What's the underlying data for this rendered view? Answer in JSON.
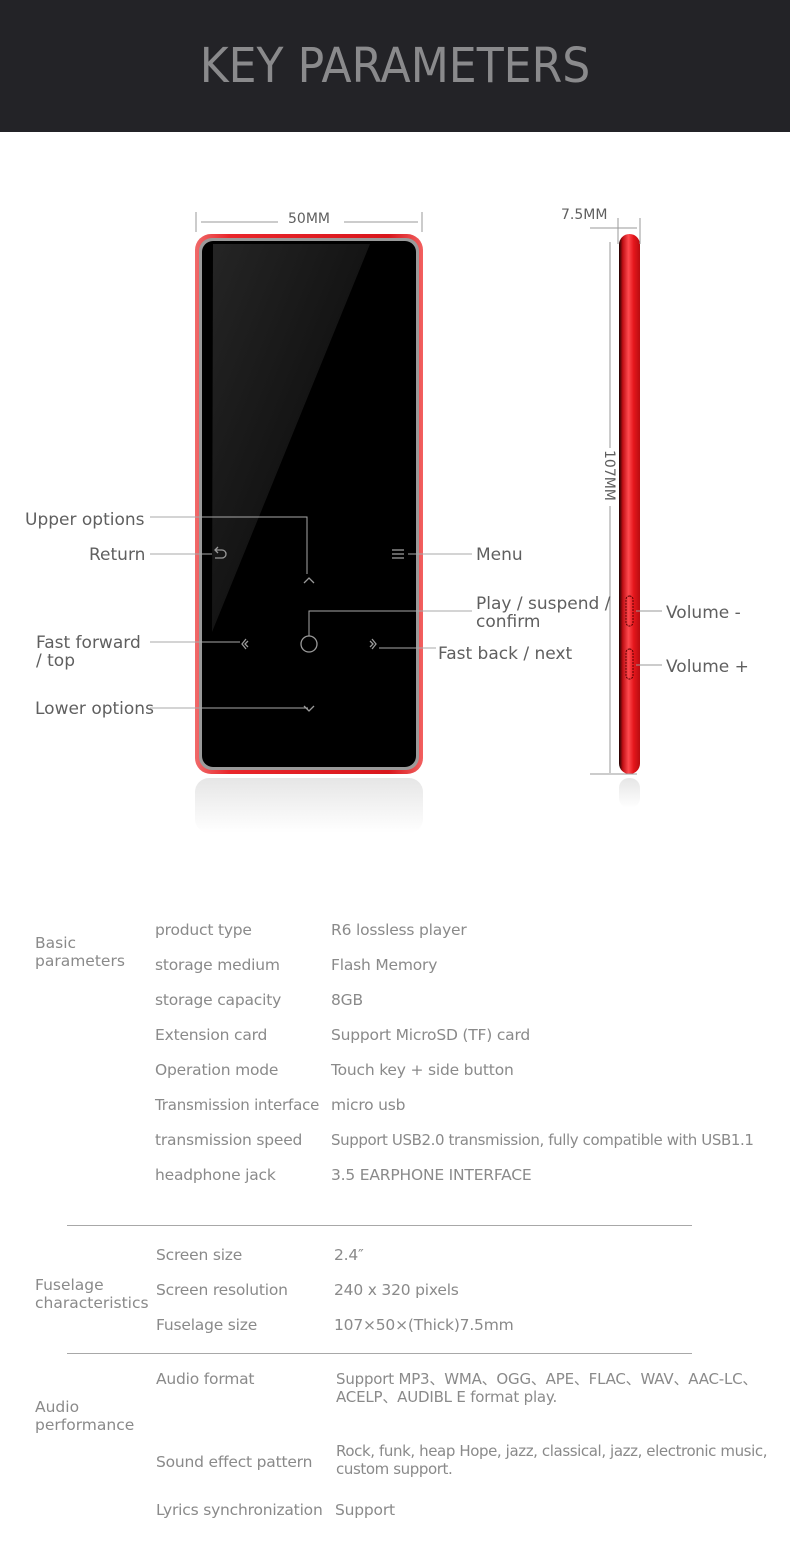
{
  "header": {
    "title": "KEY PARAMETERS"
  },
  "colors": {
    "header_bg": "#232327",
    "device_red": "#e8262b",
    "screen": "#000000",
    "text": "#8a8a8a"
  },
  "dimensions": {
    "width": "50MM",
    "thickness": "7.5MM",
    "height": "107MM"
  },
  "callouts": {
    "upper_options": "Upper options",
    "return": "Return",
    "menu": "Menu",
    "play_line1": "Play / suspend /",
    "play_line2": "confirm",
    "fast_forward_line1": "Fast forward",
    "fast_forward_line2": "/ top",
    "fast_back": "Fast back / next",
    "lower_options": "Lower options",
    "volume_minus": "Volume -",
    "volume_plus": "Volume +"
  },
  "icons": {
    "return": "return-arrow-icon",
    "up": "chevron-up-icon",
    "menu": "menu-lines-icon",
    "play": "circle-play-icon",
    "prev": "double-chevron-left-icon",
    "next": "double-chevron-right-icon",
    "down": "chevron-down-icon"
  },
  "specs": [
    {
      "group_line1": "Basic",
      "group_line2": "parameters",
      "rows": [
        {
          "key": "product type",
          "value": "R6 lossless player"
        },
        {
          "key": "storage medium",
          "value": "Flash Memory"
        },
        {
          "key": "storage capacity",
          "value": "8GB"
        },
        {
          "key": "Extension card",
          "value": "Support MicroSD (TF) card"
        },
        {
          "key": "Operation mode",
          "value": "Touch key + side button"
        },
        {
          "key": "Transmission interface",
          "value": "micro usb"
        },
        {
          "key": "transmission speed",
          "value": "Support USB2.0 transmission, fully compatible with USB1.1"
        },
        {
          "key": "headphone jack",
          "value": "3.5 EARPHONE INTERFACE"
        }
      ]
    },
    {
      "group_line1": "Fuselage",
      "group_line2": "characteristics",
      "rows": [
        {
          "key": "Screen size",
          "value": "2.4″"
        },
        {
          "key": "Screen resolution",
          "value": "240 x 320 pixels"
        },
        {
          "key": "Fuselage size",
          "value": "107×50×(Thick)7.5mm"
        }
      ]
    },
    {
      "group_line1": "Audio",
      "group_line2": "performance",
      "rows": [
        {
          "key": "Audio format",
          "value_line1": "Support MP3、WMA、OGG、APE、FLAC、WAV、AAC-LC、",
          "value_line2": "ACELP、AUDIBL E  format play."
        },
        {
          "key": "Sound effect pattern",
          "value_line1": "Rock, funk, heap Hope, jazz, classical, jazz, electronic music,",
          "value_line2": "custom support."
        },
        {
          "key": "Lyrics synchronization",
          "value": "Support"
        }
      ]
    }
  ]
}
